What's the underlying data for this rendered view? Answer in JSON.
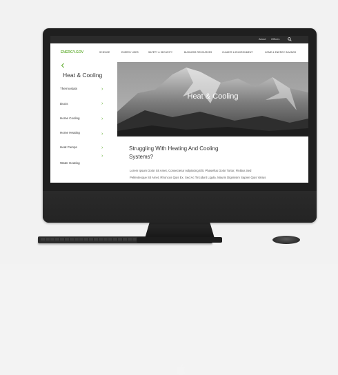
{
  "topbar": {
    "links": [
      "About",
      "Offices"
    ],
    "search_icon": "search-icon"
  },
  "nav": {
    "brand": "ENERGY.GOV",
    "items": [
      "SCIENCE",
      "ENERGY USES",
      "SAFETY & SECURITY",
      "BUSINESS RESOURCES",
      "CLIMATE & ENVIRONMENT",
      "HOME & ENERGY SAVINGS"
    ]
  },
  "sidebar": {
    "back_icon": "chevron-left-icon",
    "title": "Heat & Cooling",
    "items": [
      "Thermostats",
      "Ducts",
      "Home Cooling",
      "Home Heating",
      "Heat Pumps",
      "Water Heating"
    ]
  },
  "hero": {
    "title": "Heat & Cooling"
  },
  "content": {
    "heading": "Struggling With Heating And Cooling Systems?",
    "body": [
      "Lorem Ipsum Dolor Sit Amet, Consectetur Adipiscing Elit. Phasellus Dolor Tortor, Finibus Sed",
      "Pellentesque Sit Amet, Rhoncus Quis Ex. Sed Ac Tincidunt Ligula. Mauris Dignissim Sapien Quis Varius"
    ]
  },
  "colors": {
    "accent": "#6cb33f",
    "topbar": "#2b2b2b",
    "bezel": "#1f1f1f"
  }
}
